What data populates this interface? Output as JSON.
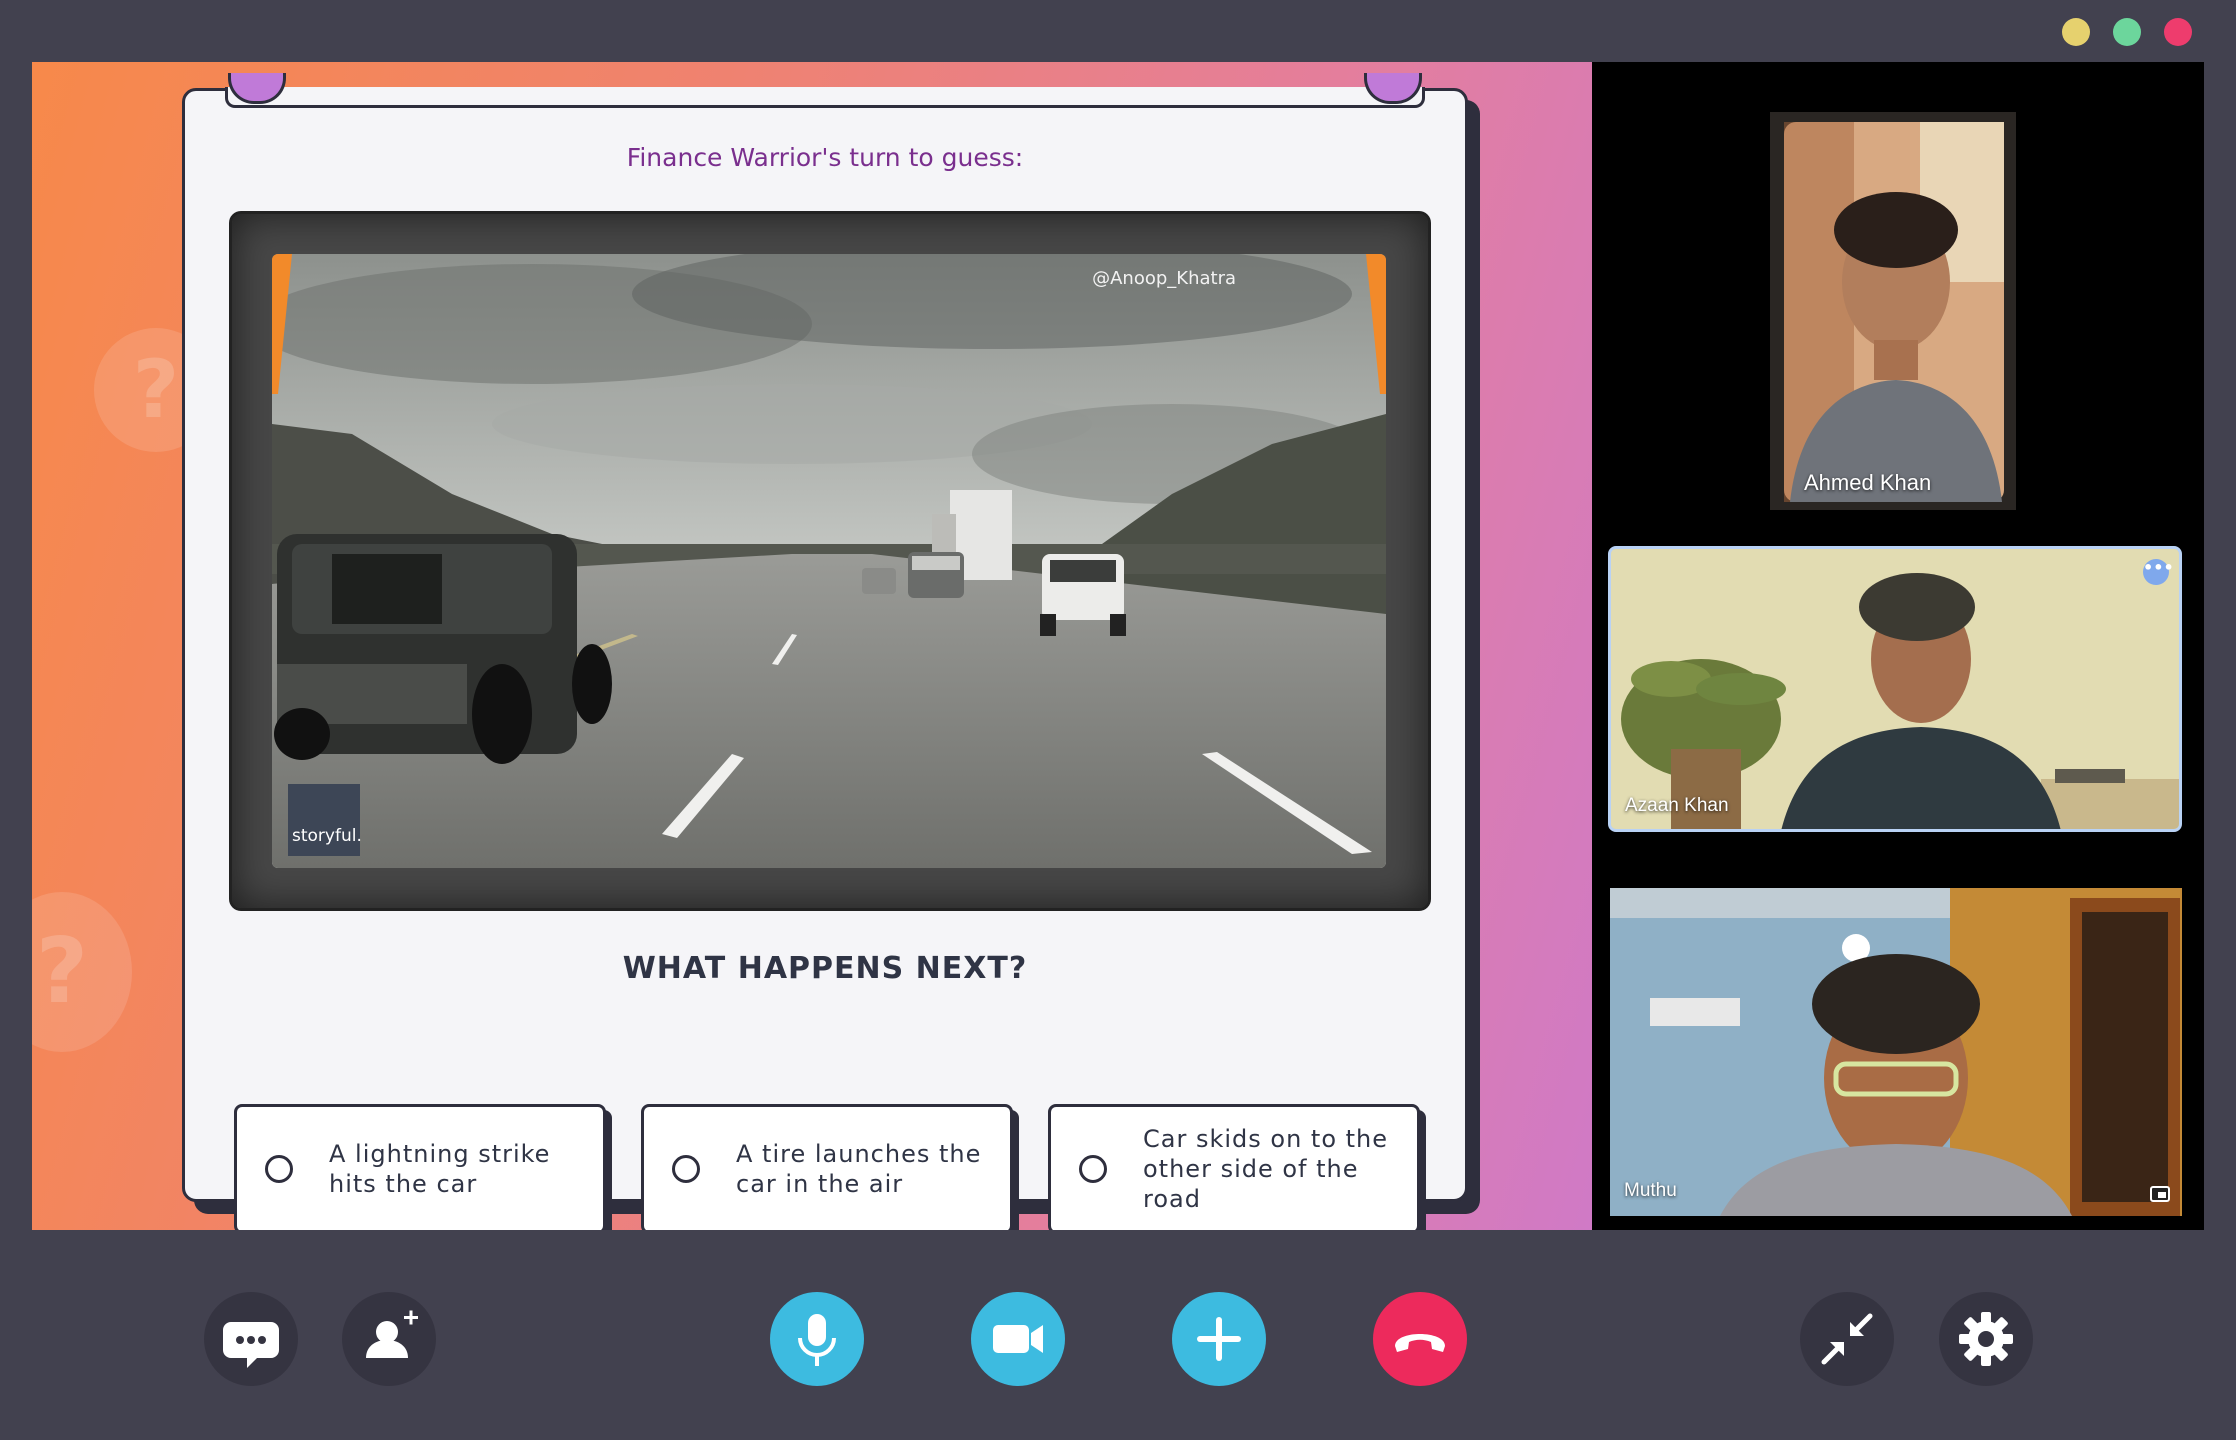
{
  "window": {
    "controls": [
      {
        "name": "minimize",
        "color": "#e6d16e"
      },
      {
        "name": "maximize",
        "color": "#6cd69c"
      },
      {
        "name": "close",
        "color": "#ee3c6d"
      }
    ]
  },
  "game": {
    "turn_text": "Finance Warrior's turn to guess:",
    "video": {
      "watermark": "@Anoop_Khatra",
      "logo": "storyful."
    },
    "question": "WHAT HAPPENS NEXT?",
    "options": [
      {
        "label": "A lightning strike hits the car"
      },
      {
        "label": "A tire launches the car in the air"
      },
      {
        "label": "Car skids on to the other side of the road"
      }
    ]
  },
  "participants": [
    {
      "name": "Ahmed Khan"
    },
    {
      "name": "Azaan Khan",
      "more_icon": "more-options-icon",
      "active": true
    },
    {
      "name": "Muthu",
      "icon": "pip-icon"
    }
  ],
  "controls": {
    "left": [
      {
        "name": "chat",
        "icon": "chat-bubble-icon"
      },
      {
        "name": "add-person",
        "icon": "add-person-icon"
      }
    ],
    "center": [
      {
        "name": "microphone",
        "icon": "microphone-icon",
        "color": "#3dbbe0"
      },
      {
        "name": "camera",
        "icon": "video-camera-icon",
        "color": "#3dbbe0"
      },
      {
        "name": "add",
        "icon": "plus-icon",
        "color": "#3dbbe0"
      },
      {
        "name": "end-call",
        "icon": "hang-up-icon",
        "color": "#ed2a5c"
      }
    ],
    "right": [
      {
        "name": "minimize-view",
        "icon": "collapse-arrows-icon"
      },
      {
        "name": "settings",
        "icon": "gear-icon"
      }
    ],
    "dark_button_color": "#353441"
  }
}
